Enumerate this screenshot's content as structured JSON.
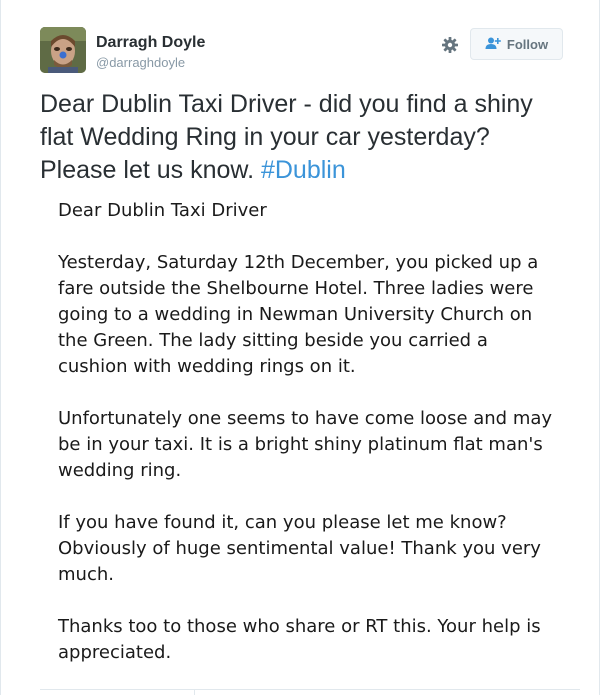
{
  "user": {
    "display_name": "Darragh Doyle",
    "screen_name": "@darraghdoyle",
    "avatar_icon": "profile-photo"
  },
  "actions": {
    "settings_icon": "gear-icon",
    "follow_label": "Follow",
    "follow_icon": "add-user-icon"
  },
  "tweet": {
    "text": "Dear Dublin Taxi Driver - did you find a shiny flat Wedding Ring in your car yesterday? Please let us know. ",
    "hashtag": "#Dublin"
  },
  "image_note": {
    "greeting": "Dear Dublin Taxi Driver",
    "paragraph1": "Yesterday, Saturday 12th December, you picked up a fare outside the Shelbourne Hotel. Three ladies were going to a wedding in Newman University Church on the Green. The lady sitting beside you carried a cushion with wedding rings on it.",
    "paragraph2": "Unfortunately one seems to have come loose and may be in your taxi. It is a bright shiny platinum flat man's wedding ring.",
    "paragraph3": "If you have found it, can you please let me know? Obviously of huge sentimental value! Thank you very much.",
    "paragraph4": "Thanks too to those who share or RT this. Your help is appreciated."
  },
  "colors": {
    "link": "#3b94d9",
    "muted": "#8899a6",
    "text": "#292f33",
    "border": "#e1e8ed"
  }
}
